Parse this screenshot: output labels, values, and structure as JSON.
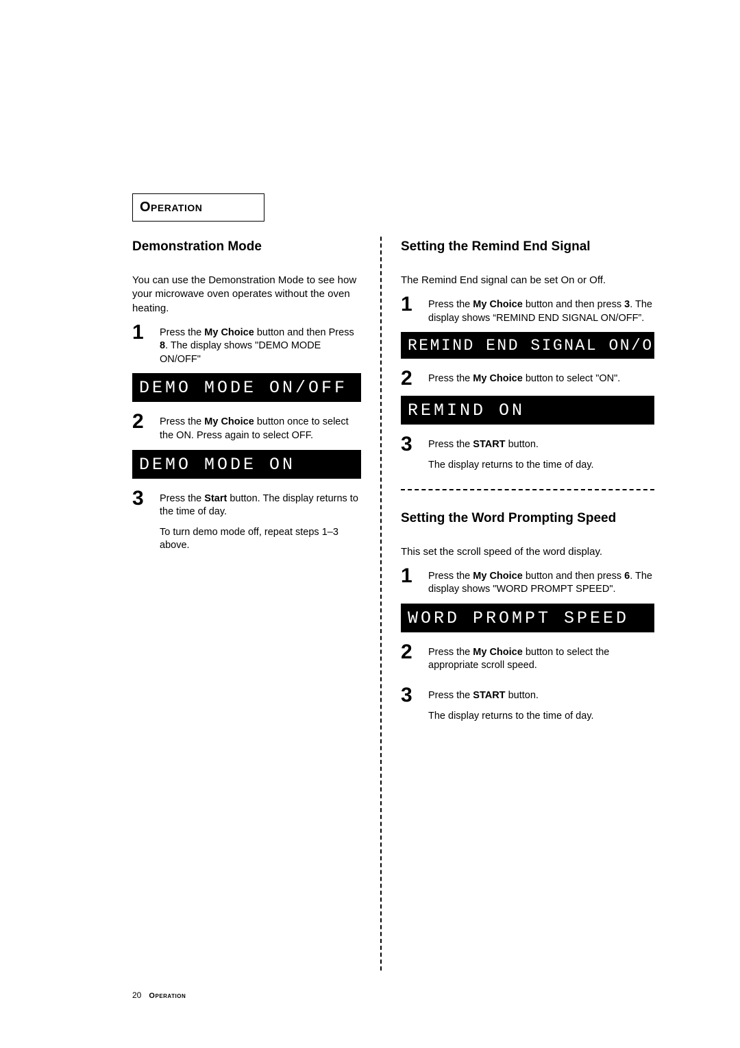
{
  "section_tab": "Operation",
  "left": {
    "heading": "Demonstration Mode",
    "intro": "You can use the Demonstration Mode to see how your microwave oven operates without the oven heating.",
    "step1": {
      "n": "1",
      "t1": "Press the ",
      "b1": "My Choice",
      "t2": " button and then Press ",
      "b2": "8",
      "t3": ". The display shows \"DEMO MODE ON/OFF\""
    },
    "lcd1": "DEMO MODE ON/OFF",
    "step2": {
      "n": "2",
      "t1": "Press the ",
      "b1": "My Choice",
      "t2": " button once to select the ON. Press again to select OFF."
    },
    "lcd2": "DEMO MODE ON",
    "step3": {
      "n": "3",
      "t1": "Press the ",
      "b1": "Start",
      "t2": " button. The display returns to the time of day.",
      "sub": "To turn demo mode off, repeat steps 1–3 above."
    }
  },
  "right": {
    "sec1": {
      "heading": "Setting the Remind End Signal",
      "intro": "The Remind End signal can be set On or Off.",
      "step1": {
        "n": "1",
        "t1": "Press the ",
        "b1": "My Choice",
        "t2": " button and then press ",
        "b2": "3",
        "t3": ". The display shows “REMIND END SIGNAL ON/OFF”."
      },
      "lcd1": "REMIND END SIGNAL ON/OFF",
      "step2": {
        "n": "2",
        "t1": "Press the ",
        "b1": "My Choice",
        "t2": " button to select  \"ON\"."
      },
      "lcd2": "REMIND ON",
      "step3": {
        "n": "3",
        "t1": "Press the ",
        "b1": "START",
        "t2": " button.",
        "sub": "The display returns to the time of day."
      }
    },
    "sec2": {
      "heading": "Setting the Word Prompting Speed",
      "intro": "This set the scroll speed of the word display.",
      "step1": {
        "n": "1",
        "t1": "Press the ",
        "b1": "My Choice",
        "t2": " button and then press ",
        "b2": "6",
        "t3": ". The display shows \"WORD PROMPT SPEED\"."
      },
      "lcd1": "WORD PROMPT SPEED",
      "step2": {
        "n": "2",
        "t1": "Press the ",
        "b1": "My Choice",
        "t2": " button to select the appropriate scroll speed."
      },
      "step3": {
        "n": "3",
        "t1": "Press the ",
        "b1": "START",
        "t2": " button.",
        "sub": "The display returns to the time of day."
      }
    }
  },
  "footer": {
    "page": "20",
    "label": "Operation"
  }
}
